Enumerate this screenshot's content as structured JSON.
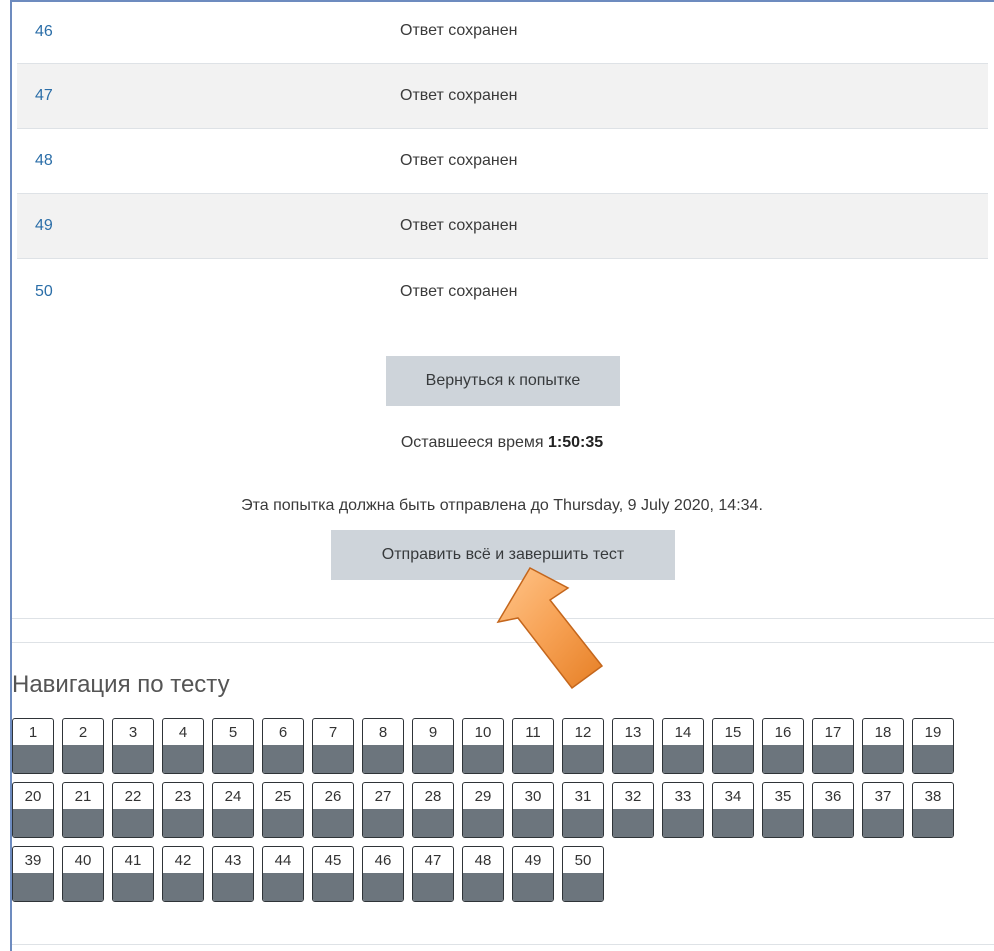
{
  "summary": {
    "rows": [
      {
        "num": "46",
        "status": "Ответ сохранен"
      },
      {
        "num": "47",
        "status": "Ответ сохранен"
      },
      {
        "num": "48",
        "status": "Ответ сохранен"
      },
      {
        "num": "49",
        "status": "Ответ сохранен"
      },
      {
        "num": "50",
        "status": "Ответ сохранен"
      }
    ]
  },
  "actions": {
    "return_label": "Вернуться к попытке",
    "time_label": "Оставшееся время",
    "time_value": "1:50:35",
    "due_text": "Эта попытка должна быть отправлена до Thursday, 9 July 2020, 14:34.",
    "submit_label": "Отправить всё и завершить тест"
  },
  "navigation": {
    "title": "Навигация по тесту",
    "rows": [
      [
        "1",
        "2",
        "3",
        "4",
        "5",
        "6",
        "7",
        "8",
        "9",
        "10",
        "11",
        "12",
        "13",
        "14",
        "15",
        "16",
        "17",
        "18",
        "19"
      ],
      [
        "20",
        "21",
        "22",
        "23",
        "24",
        "25",
        "26",
        "27",
        "28",
        "29",
        "30",
        "31",
        "32",
        "33",
        "34",
        "35",
        "36",
        "37",
        "38"
      ],
      [
        "39",
        "40",
        "41",
        "42",
        "43",
        "44",
        "45",
        "46",
        "47",
        "48",
        "49",
        "50"
      ]
    ]
  },
  "colors": {
    "link": "#2b6ea8",
    "button_bg": "#ced4da",
    "answered_fill": "#6c757d",
    "arrow": "#f5a04f"
  }
}
